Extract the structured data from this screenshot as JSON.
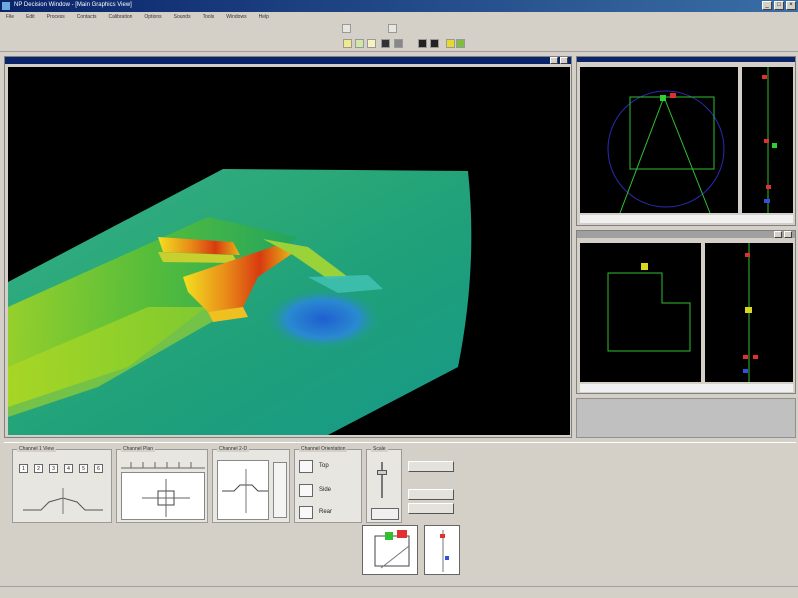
{
  "window": {
    "title": "NP Decision Window - [Main Graphics View]"
  },
  "menu": [
    "File",
    "Edit",
    "Process",
    "Contacts",
    "Calibration",
    "Options",
    "Sounds",
    "Tools",
    "Windows",
    "Help"
  ],
  "main_view": {
    "title": "",
    "overlay_label": ""
  },
  "top_view": {
    "status_left": "",
    "status_mid": "",
    "status_right": ""
  },
  "bottom_view": {
    "title": "",
    "status_left": ""
  },
  "panel": {
    "group1": {
      "title": "Channel 1 View",
      "sub": "",
      "buttons": [
        "1",
        "2",
        "3",
        "4",
        "5",
        "6"
      ],
      "info": ""
    },
    "group2": {
      "title": "Channel Plan",
      "info": ""
    },
    "group3": {
      "title": "Channel 2-D",
      "info": ""
    },
    "group4": {
      "title": "Channel Orientation",
      "items": [
        "Top",
        "Side",
        "Rear"
      ],
      "info": ""
    },
    "group5": {
      "title": "Scale"
    },
    "actions": [
      "",
      "",
      ""
    ],
    "thumbs": [
      "",
      ""
    ]
  },
  "status": {
    "left": "",
    "right": ""
  },
  "colors": {
    "accent": "#0a246a",
    "terrain_low": "#1f6fd0",
    "terrain_mid": "#26b07a",
    "terrain_high": "#d23a12"
  }
}
